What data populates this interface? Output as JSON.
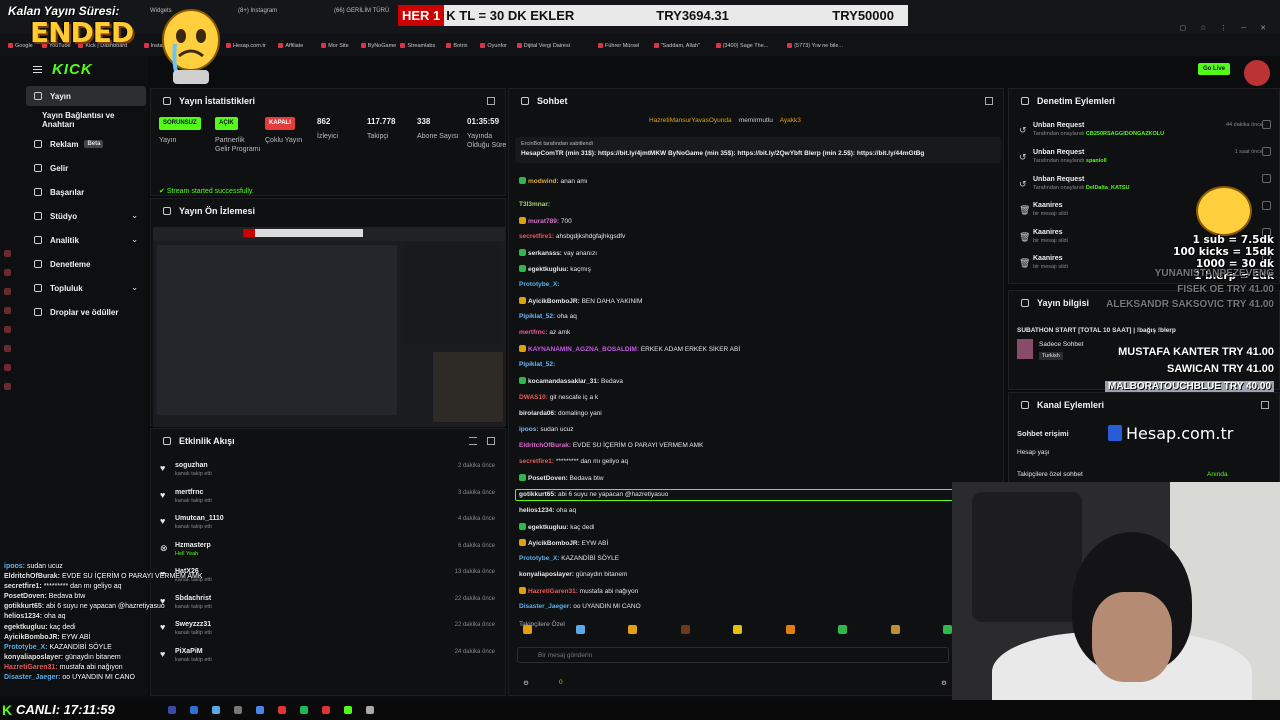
{
  "overlay": {
    "timer_title": "Kalan Yayın Süresi:",
    "ended": "ENDED",
    "bar_red": "HER 1",
    "bar_text": "K TL = 30 DK EKLER",
    "bar_current": "TRY3694.31",
    "bar_goal": "TRY50000",
    "sub_lines": [
      "1 sub = 7.5dk",
      "100 kicks = 15dk",
      "1000 = 30 dk",
      "1 blerp = 2dk"
    ],
    "donations": [
      {
        "text": "YUNANISTANPEZEVENG",
        "amount": "",
        "style": "faded"
      },
      {
        "text": "FISEK OE TRY 41.00",
        "amount": "",
        "style": "faded"
      },
      {
        "text": "ALEKSANDR SAKSOVIC TRY 41.00",
        "amount": "",
        "style": "faded"
      },
      {
        "text": "MUSTAFA KANTER TRY 41.00",
        "amount": "",
        "style": "normal"
      },
      {
        "text": "SAWICAN TRY 41.00",
        "amount": "",
        "style": "normal"
      },
      {
        "text": "MALBORATOUCHBLUE TRY 40.00",
        "amount": "",
        "style": "boxed"
      }
    ],
    "hesap": "Hesap.com.tr",
    "canli": "CANLI: 17:11:59",
    "mini_chat": [
      {
        "user": "ipoos:",
        "msg": "sudan ucuz"
      },
      {
        "user": "EldritchOfBurak:",
        "msg": "EVDE SU İÇERİM O PARAYI VERMEM AMK"
      },
      {
        "user": "secretfire1:",
        "msg": "********* dan mı geliyo aq"
      },
      {
        "user": "PosetDoven:",
        "msg": "Bedava btw"
      },
      {
        "user": "gotikkurt65:",
        "msg": "abi 6 suyu ne yapacan @hazretiyasuo"
      },
      {
        "user": "helios1234:",
        "msg": "oha aq"
      },
      {
        "user": "egektkugluu:",
        "msg": "kaç dedi"
      },
      {
        "user": "AyicikBomboJR:",
        "msg": "EYW ABİ"
      },
      {
        "user": "Prototybe_X:",
        "msg": "KAZANDİBİ SÖYLE"
      },
      {
        "user": "konyaliaposlayer:",
        "msg": "günaydın bitanem"
      },
      {
        "user": "HazretiGaren31:",
        "msg": "mustafa abi nağıyon"
      },
      {
        "user": "Disaster_Jaeger:",
        "msg": "oo UYANDIN MI CANO"
      }
    ]
  },
  "browser": {
    "tabs": [
      "Widgets",
      "(8+) Instagram",
      "(66) GERİLİM TÜRÜ"
    ],
    "bookmarks": [
      "Google",
      "YouTube",
      "Kick | Dashboard",
      "Instagram",
      "WhatsApp",
      "Hesap.com.tr",
      "Affiliate",
      "Mor Site",
      "ByNoGame",
      "Streamlabs",
      "Botrix",
      "Oyunfor",
      "Dijital Vergi Dairesi",
      "Führer Mürsel",
      "\"Saddam, Allah\"",
      "(3400) Sage The...",
      "(5773) Yıw ne bile..."
    ]
  },
  "sidebar": {
    "logo": "KICK",
    "items": [
      {
        "label": "Yayın",
        "active": true,
        "chev": false,
        "sub": false
      },
      {
        "label": "Yayın Bağlantısı ve Anahtarı",
        "active": false,
        "chev": false,
        "sub": true
      },
      {
        "label": "Reklam",
        "badge": "Beta",
        "active": false,
        "chev": false,
        "sub": false
      },
      {
        "label": "Gelir",
        "active": false,
        "chev": false,
        "sub": false
      },
      {
        "label": "Başarılar",
        "active": false,
        "chev": false,
        "sub": false
      },
      {
        "label": "Stüdyo",
        "active": false,
        "chev": true,
        "sub": false
      },
      {
        "label": "Analitik",
        "active": false,
        "chev": true,
        "sub": false
      },
      {
        "label": "Denetleme",
        "active": false,
        "chev": false,
        "sub": false
      },
      {
        "label": "Topluluk",
        "active": false,
        "chev": true,
        "sub": false
      },
      {
        "label": "Droplar ve ödüller",
        "active": false,
        "chev": false,
        "sub": false
      }
    ]
  },
  "stats": {
    "title": "Yayın İstatistikleri",
    "items": [
      {
        "pill": "SORUNSUZ",
        "color": "#53fc18",
        "label": "Yayın"
      },
      {
        "pill": "AÇIK",
        "color": "#53fc18",
        "label": "Partnerlik Gelir Programı"
      },
      {
        "pill": "KAPALI",
        "color": "#e43b3b",
        "label": "Çoklu Yayın"
      },
      {
        "num": "862",
        "label": "İzleyici"
      },
      {
        "num": "117.778",
        "label": "Takipçi"
      },
      {
        "num": "338",
        "label": "Abone Sayısı"
      },
      {
        "num": "01:35:59",
        "label": "Yayında Olduğu Süre"
      }
    ],
    "status": "Stream started successfully."
  },
  "preview": {
    "title": "Yayın Ön İzlemesi"
  },
  "activity": {
    "title": "Etkinlik Akışı",
    "items": [
      {
        "user": "soguzhan",
        "sub": "kanalı takip etti",
        "time": "2 dakika önce"
      },
      {
        "user": "mertfrnc",
        "sub": "kanalı takip etti",
        "time": "3 dakika önce"
      },
      {
        "user": "Umutcan_1110",
        "sub": "kanalı takip etti",
        "time": "4 dakika önce"
      },
      {
        "user": "Hzmasterp",
        "sub": "Hell Yeah",
        "time": "6 dakika önce"
      },
      {
        "user": "HatX26",
        "sub": "kanalı takip etti",
        "time": "13 dakika önce"
      },
      {
        "user": "Sbdachrist",
        "sub": "kanalı takip etti",
        "time": "22 dakika önce"
      },
      {
        "user": "Sweyzzz31",
        "sub": "kanalı takip etti",
        "time": "22 dakika önce"
      },
      {
        "user": "PiXaPiM",
        "sub": "kanalı takip etti",
        "time": "24 dakika önce"
      }
    ]
  },
  "chat": {
    "title": "Sohbet",
    "top_users": [
      "HazretiMansurYavasOyunda",
      "memirmutlu",
      "Ayakk3"
    ],
    "pinned_by": "ErcinBot tarafından sabitlendi",
    "pinned_msg": "HesapComTR (min 31$): https://bit.ly/4jmtMKW ByNoGame (min 35$): https://bit.ly/2QwYbft Blerp (min 2.5$): https://bit.ly/44mGtBg",
    "messages": [
      {
        "user": "modwind:",
        "msg": "anan amı",
        "color": "#d9a93b",
        "badge": "g"
      },
      {
        "user": "T3l3mnar:",
        "msg": "",
        "color": "#9fd36b",
        "badge": ""
      },
      {
        "user": "murat789:",
        "msg": "700",
        "color": "#d96bd0",
        "badge": "o"
      },
      {
        "user": "secretfire1:",
        "msg": "ahsbgdjkshdgfajhkgsdfv",
        "color": "#e85a5a",
        "badge": ""
      },
      {
        "user": "serkansss:",
        "msg": "vay ananızı",
        "color": "#e6e6e6",
        "badge": "g"
      },
      {
        "user": "egektkugluu:",
        "msg": "kaçmış",
        "color": "#e6e6e6",
        "badge": "g"
      },
      {
        "user": "Prototybe_X:",
        "msg": "",
        "color": "#5ab0e8",
        "badge": ""
      },
      {
        "user": "AyicikBomboJR:",
        "msg": "BEN DAHA YAKINIM",
        "color": "#e6e6e6",
        "badge": "o"
      },
      {
        "user": "Pipiklat_52:",
        "msg": "oha aq",
        "color": "#6bb8ff",
        "badge": ""
      },
      {
        "user": "mertfrnc:",
        "msg": "az amk",
        "color": "#e85a9a",
        "badge": ""
      },
      {
        "user": "KAYNANAMIN_AGZNA_BOSALDIM:",
        "msg": "ERKEK ADAM ERKEK SİKER ABİ",
        "color": "#c85ae8",
        "badge": "o"
      },
      {
        "user": "Pipiklat_52:",
        "msg": "",
        "color": "#6bb8ff",
        "badge": ""
      },
      {
        "user": "kocamandassaklar_31:",
        "msg": "Bedava",
        "color": "#e6e6e6",
        "badge": "g"
      },
      {
        "user": "DWAS10:",
        "msg": "git nescafe iç a k",
        "color": "#e85a5a",
        "badge": ""
      },
      {
        "user": "birolarda06:",
        "msg": "domalingo yani",
        "color": "#e6e6e6",
        "badge": ""
      },
      {
        "user": "ipoos:",
        "msg": "sudan ucuz",
        "color": "#6bb8ff",
        "badge": ""
      },
      {
        "user": "EldritchOfBurak:",
        "msg": "EVDE SU İÇERİM O PARAYI VERMEM AMK",
        "color": "#d96bd0",
        "badge": ""
      },
      {
        "user": "secretfire1:",
        "msg": "********* dan mı geliyo aq",
        "color": "#e85a5a",
        "badge": ""
      },
      {
        "user": "PosetDoven:",
        "msg": "Bedava btw",
        "color": "#e6e6e6",
        "badge": "g"
      },
      {
        "user": "gotikkurt65:",
        "msg": "abi 6 suyu ne yapacan @hazretiyasuo",
        "color": "#e6e6e6",
        "badge": ""
      },
      {
        "user": "helios1234:",
        "msg": "oha aq",
        "color": "#e6e6e6",
        "badge": ""
      },
      {
        "user": "egektkugluu:",
        "msg": "kaç dedi",
        "color": "#e6e6e6",
        "badge": "g"
      },
      {
        "user": "AyicikBomboJR:",
        "msg": "EYW ABİ",
        "color": "#e6e6e6",
        "badge": "o"
      },
      {
        "user": "Prototybe_X:",
        "msg": "KAZANDİBİ SÖYLE",
        "color": "#5ab0e8",
        "badge": ""
      },
      {
        "user": "konyaliaposlayer:",
        "msg": "günaydın bitanem",
        "color": "#e6e6e6",
        "badge": ""
      },
      {
        "user": "HazretiGaren31:",
        "msg": "mustafa abi nağıyon",
        "color": "#e85a5a",
        "badge": "o"
      },
      {
        "user": "Disaster_Jaeger:",
        "msg": "oo UYANDIN MI CANO",
        "color": "#5ab0e8",
        "badge": ""
      }
    ],
    "followers_only": "Takipçilere Özel",
    "input_placeholder": "Bir mesaj gönderin",
    "count": "0"
  },
  "mod_actions": {
    "title": "Denetim Eylemleri",
    "items": [
      {
        "action": "Unban Request",
        "by": "CB250RSAGGIDONGAZKOLU",
        "prefix": "Tarafından onaylandı",
        "time": "44 dakika önce"
      },
      {
        "action": "Unban Request",
        "by": "spanioll",
        "prefix": "Tarafından onaylandı",
        "time": "1 saat önce"
      },
      {
        "action": "Unban Request",
        "by": "DelDalta_KATSU",
        "prefix": "Tarafından onaylandı",
        "time": ""
      },
      {
        "action": "Kaanires",
        "by": "",
        "prefix": "bir mesajı sildi",
        "time": ""
      },
      {
        "action": "Kaanires",
        "by": "",
        "prefix": "bir mesajı sildi",
        "time": ""
      },
      {
        "action": "Kaanires",
        "by": "",
        "prefix": "bir mesajı sildi",
        "time": ""
      }
    ]
  },
  "stream_info": {
    "title": "Yayın bilgisi",
    "stream_title": "SUBATHON START [TOTAL 10 SAAT] | !bağış !blerp",
    "category": "Sadece Sohbet",
    "language": "Turkish"
  },
  "channel_actions": {
    "title": "Kanal Eylemleri",
    "chat_access": "Sohbet erişimi",
    "account_age": "Hesap yaşı",
    "followers_only": "Takipçilere özel sohbet",
    "followers_value": "Anında"
  },
  "header": {
    "go_live": "Go Live"
  }
}
